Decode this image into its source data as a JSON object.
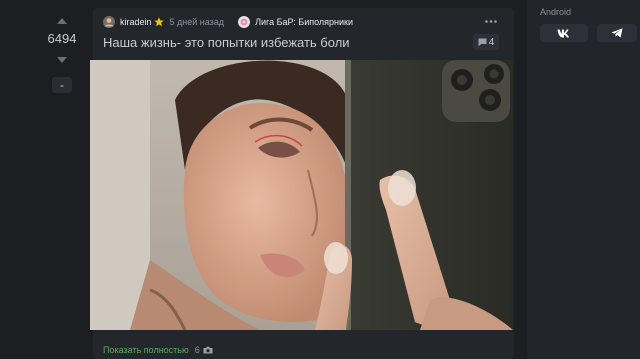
{
  "sidebar": {
    "platform_label": "Android",
    "share_buttons": [
      {
        "icon": "vk-icon",
        "label": "VK"
      },
      {
        "icon": "telegram-icon",
        "label": "Telegram"
      }
    ]
  },
  "votes": {
    "count": "6494",
    "save_label": "-"
  },
  "post": {
    "author": "kiradein",
    "time": "5 дней назад",
    "community": "Лига БаР: Биполярники",
    "title": "Наша жизнь- это попытки избежать боли",
    "comments_count": "4",
    "show_more_label": "Показать полностью",
    "photo_count": "6"
  },
  "colors": {
    "accent_green": "#5fae5f",
    "star": "#f0c400",
    "background": "#1c1e22",
    "card": "#23262b"
  }
}
